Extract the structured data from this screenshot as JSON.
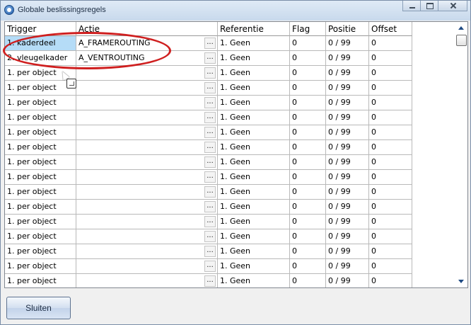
{
  "window": {
    "title": "Globale beslissingsregels",
    "icons": {
      "app": "app-logo-icon",
      "minimize": "minimize-icon",
      "maximize": "maximize-icon",
      "close": "close-icon"
    }
  },
  "grid": {
    "columns": [
      "Trigger",
      "Actie",
      "Referentie",
      "Flag",
      "Positie",
      "Offset"
    ],
    "ellipsis": "...",
    "selected_cell": {
      "row": 0,
      "column": "Trigger",
      "color": "#b5dcf7"
    },
    "rows": [
      {
        "trigger": "1. kaderdeel",
        "actie": "A_FRAMEROUTING",
        "referentie": "1. Geen",
        "flag": "0",
        "positie": "0 / 99",
        "offset": "0"
      },
      {
        "trigger": "2. vleugelkader",
        "actie": "A_VENTROUTING",
        "referentie": "1. Geen",
        "flag": "0",
        "positie": "0 / 99",
        "offset": "0"
      },
      {
        "trigger": "1. per object",
        "actie": "",
        "referentie": "1. Geen",
        "flag": "0",
        "positie": "0 / 99",
        "offset": "0"
      },
      {
        "trigger": "1. per object",
        "actie": "",
        "referentie": "1. Geen",
        "flag": "0",
        "positie": "0 / 99",
        "offset": "0"
      },
      {
        "trigger": "1. per object",
        "actie": "",
        "referentie": "1. Geen",
        "flag": "0",
        "positie": "0 / 99",
        "offset": "0"
      },
      {
        "trigger": "1. per object",
        "actie": "",
        "referentie": "1. Geen",
        "flag": "0",
        "positie": "0 / 99",
        "offset": "0"
      },
      {
        "trigger": "1. per object",
        "actie": "",
        "referentie": "1. Geen",
        "flag": "0",
        "positie": "0 / 99",
        "offset": "0"
      },
      {
        "trigger": "1. per object",
        "actie": "",
        "referentie": "1. Geen",
        "flag": "0",
        "positie": "0 / 99",
        "offset": "0"
      },
      {
        "trigger": "1. per object",
        "actie": "",
        "referentie": "1. Geen",
        "flag": "0",
        "positie": "0 / 99",
        "offset": "0"
      },
      {
        "trigger": "1. per object",
        "actie": "",
        "referentie": "1. Geen",
        "flag": "0",
        "positie": "0 / 99",
        "offset": "0"
      },
      {
        "trigger": "1. per object",
        "actie": "",
        "referentie": "1. Geen",
        "flag": "0",
        "positie": "0 / 99",
        "offset": "0"
      },
      {
        "trigger": "1. per object",
        "actie": "",
        "referentie": "1. Geen",
        "flag": "0",
        "positie": "0 / 99",
        "offset": "0"
      },
      {
        "trigger": "1. per object",
        "actie": "",
        "referentie": "1. Geen",
        "flag": "0",
        "positie": "0 / 99",
        "offset": "0"
      },
      {
        "trigger": "1. per object",
        "actie": "",
        "referentie": "1. Geen",
        "flag": "0",
        "positie": "0 / 99",
        "offset": "0"
      },
      {
        "trigger": "1. per object",
        "actie": "",
        "referentie": "1. Geen",
        "flag": "0",
        "positie": "0 / 99",
        "offset": "0"
      },
      {
        "trigger": "1. per object",
        "actie": "",
        "referentie": "1. Geen",
        "flag": "0",
        "positie": "0 / 99",
        "offset": "0"
      },
      {
        "trigger": "1. per object",
        "actie": "",
        "referentie": "1. Geen",
        "flag": "0",
        "positie": "0 / 99",
        "offset": "0"
      }
    ]
  },
  "annotation": {
    "shape": "ellipse",
    "color": "#cf1f1f"
  },
  "footer": {
    "close_label": "Sluiten"
  }
}
